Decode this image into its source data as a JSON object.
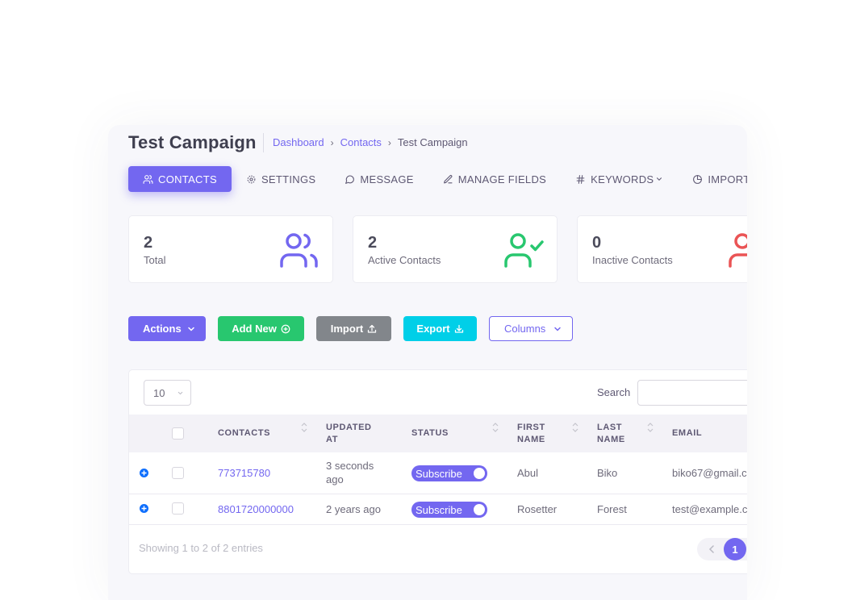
{
  "page": {
    "title": "Test Campaign"
  },
  "breadcrumb": {
    "items": [
      "Dashboard",
      "Contacts"
    ],
    "current": "Test Campaign"
  },
  "tabs": [
    {
      "label": "CONTACTS",
      "icon": "users-icon",
      "active": true
    },
    {
      "label": "SETTINGS",
      "icon": "gear-icon"
    },
    {
      "label": "MESSAGE",
      "icon": "message-circle-icon"
    },
    {
      "label": "MANAGE FIELDS",
      "icon": "edit-pen-icon"
    },
    {
      "label": "KEYWORDS",
      "icon": "hash-icon"
    },
    {
      "label": "IMPORT HISTO",
      "icon": "clock-icon"
    }
  ],
  "stats": [
    {
      "value": "2",
      "label": "Total",
      "icon": "users-icon",
      "color": "#7367f0"
    },
    {
      "value": "2",
      "label": "Active Contacts",
      "icon": "user-check-icon",
      "color": "#28c76f"
    },
    {
      "value": "0",
      "label": "Inactive Contacts",
      "icon": "user-x-icon",
      "color": "#ea5455"
    }
  ],
  "toolbar": {
    "actions_label": "Actions",
    "add_label": "Add New",
    "import_label": "Import",
    "export_label": "Export",
    "columns_label": "Columns"
  },
  "table": {
    "length_value": "10",
    "search_label": "Search",
    "search_value": "",
    "columns": [
      "CONTACTS",
      "UPDATED AT",
      "STATUS",
      "FIRST NAME",
      "LAST NAME",
      "EMAIL"
    ],
    "rows": [
      {
        "contact": "773715780",
        "updated": "3 seconds ago",
        "status": "Subscribe",
        "first": "Abul",
        "last": "Biko",
        "email": "biko67@gmail.c"
      },
      {
        "contact": "8801720000000",
        "updated": "2 years ago",
        "status": "Subscribe",
        "first": "Rosetter",
        "last": "Forest",
        "email": "test@example.c"
      }
    ],
    "info": "Showing 1 to 2 of 2 entries",
    "current_page": "1"
  },
  "colors": {
    "primary": "#7367f0",
    "success": "#28c76f",
    "secondary": "#82868b",
    "info": "#00cfe8",
    "danger": "#ea5455"
  }
}
